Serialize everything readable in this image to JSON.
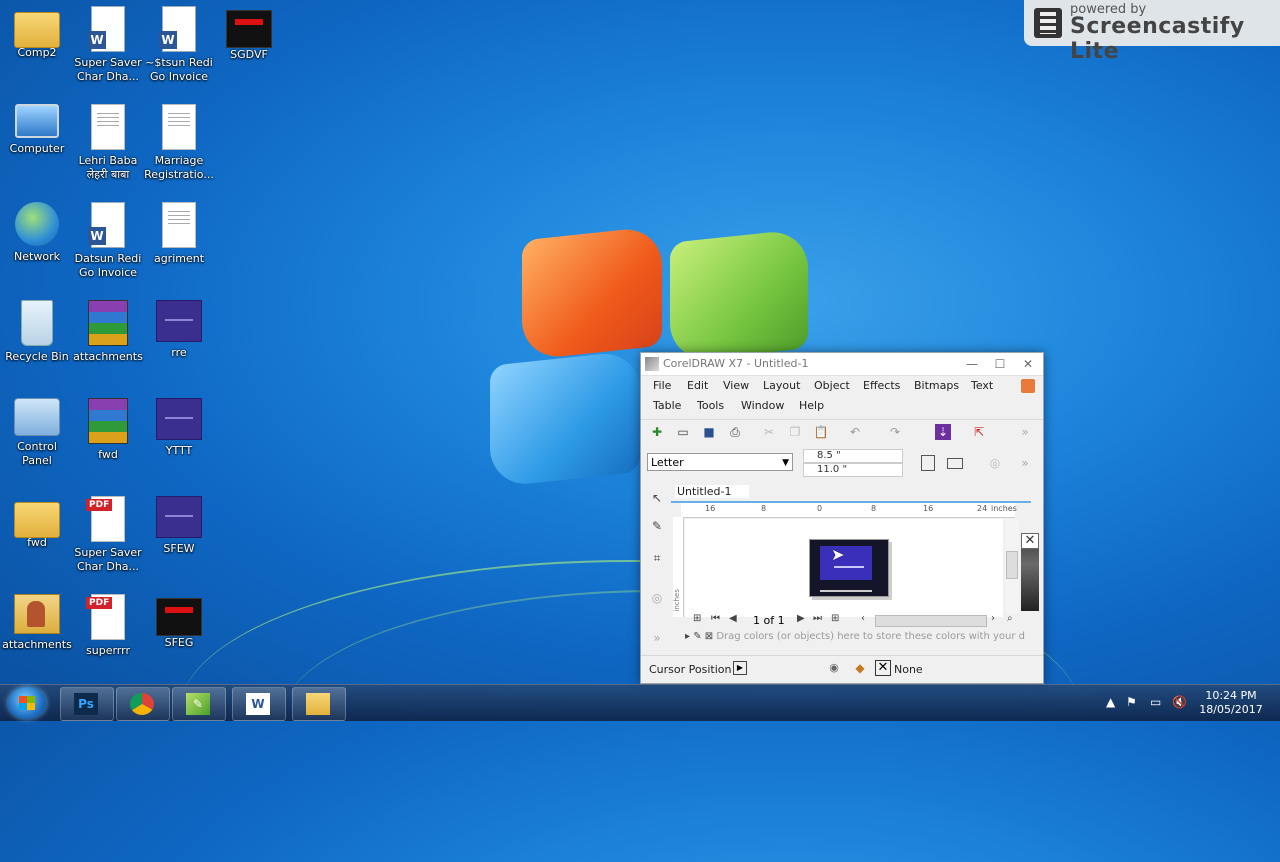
{
  "desktop": {
    "icons": [
      {
        "label": "Comp2",
        "icon": "folder-user-icon"
      },
      {
        "label": "Super Saver Char Dha...",
        "icon": "word-document-icon"
      },
      {
        "label": "~$tsun Redi Go Invoice",
        "icon": "word-document-icon"
      },
      {
        "label": "SGDVF",
        "icon": "image-thumbnail-icon"
      },
      {
        "label": "Computer",
        "icon": "computer-icon"
      },
      {
        "label": "Lehri Baba लेहरी बाबा",
        "icon": "document-icon"
      },
      {
        "label": "Marriage Registratio...",
        "icon": "document-icon"
      },
      {
        "label": "Network",
        "icon": "network-icon"
      },
      {
        "label": "Datsun Redi Go Invoice",
        "icon": "word-document-icon"
      },
      {
        "label": "agriment",
        "icon": "document-icon"
      },
      {
        "label": "Recycle Bin",
        "icon": "recycle-bin-icon"
      },
      {
        "label": "attachments",
        "icon": "winrar-archive-icon"
      },
      {
        "label": "rre",
        "icon": "image-thumbnail-icon"
      },
      {
        "label": "Control Panel",
        "icon": "control-panel-icon"
      },
      {
        "label": "fwd",
        "icon": "winrar-archive-icon"
      },
      {
        "label": "YTTT",
        "icon": "image-thumbnail-icon"
      },
      {
        "label": "fwd",
        "icon": "folder-icon"
      },
      {
        "label": "Super Saver Char Dha...",
        "icon": "pdf-document-icon"
      },
      {
        "label": "SFEW",
        "icon": "image-thumbnail-icon"
      },
      {
        "label": "attachments",
        "icon": "folder-user-icon"
      },
      {
        "label": "superrrr",
        "icon": "pdf-document-icon"
      },
      {
        "label": "SFEG",
        "icon": "image-thumbnail-icon"
      }
    ]
  },
  "watermark": {
    "line1": "powered by",
    "line2": "Screencastify Lite"
  },
  "coreldraw": {
    "title": "CorelDRAW X7 - Untitled-1",
    "menu_row1": [
      "File",
      "Edit",
      "View",
      "Layout",
      "Object",
      "Effects",
      "Bitmaps",
      "Text"
    ],
    "menu_row2": [
      "Table",
      "Tools",
      "Window",
      "Help"
    ],
    "page_size": "Letter",
    "width": "8.5 \"",
    "height": "11.0 \"",
    "doc_tab": "Untitled-1",
    "ruler_labels": [
      "16",
      "8",
      "0",
      "8",
      "16",
      "24",
      "inches"
    ],
    "vruler_label": "inches",
    "page_counter": "1 of 1",
    "dock_hint": "Drag colors (or objects) here to store these colors with your document",
    "status": {
      "cursor_position": "Cursor Position",
      "fill": "None"
    },
    "palette_dark": "#3a3a3a",
    "page_color": "#15152a"
  },
  "taskbar": {
    "apps": [
      "Photoshop",
      "Chrome",
      "CorelDRAW",
      "Word",
      "Explorer"
    ],
    "time": "10:24 PM",
    "date": "18/05/2017"
  }
}
